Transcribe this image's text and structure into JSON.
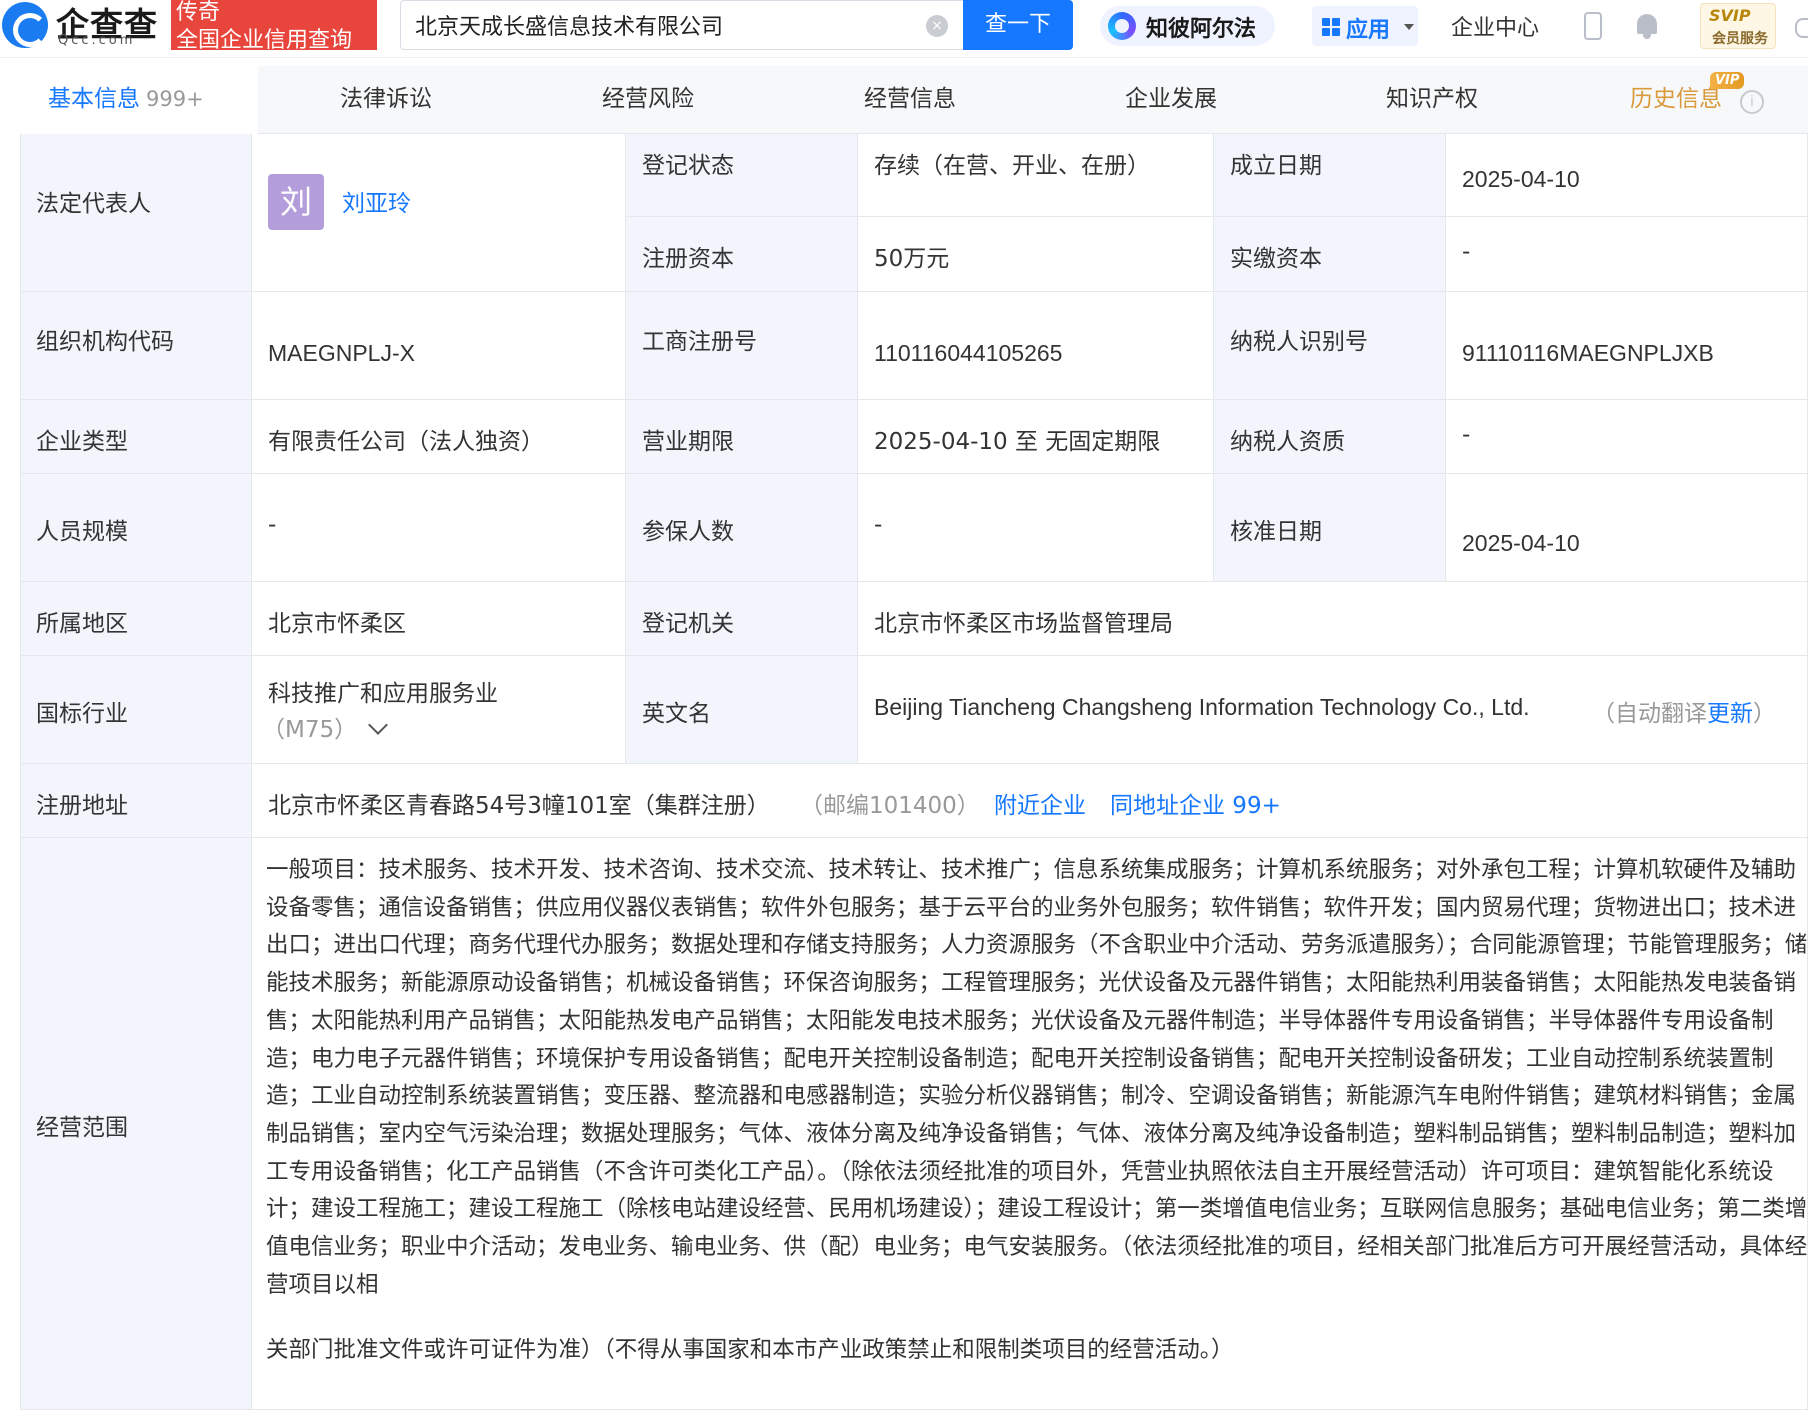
{
  "header": {
    "logo_text": "企查查",
    "logo_sub": "Qcc.com",
    "legend_badge_line1": "传奇",
    "legend_badge_line2": "全国企业信用查询",
    "search_value": "北京天成长盛信息技术有限公司",
    "search_button": "查一下",
    "zhipi_label": "知彼阿尔法",
    "apps_label": "应用",
    "enterprise_center": "企业中心",
    "svip_top": "SVIP",
    "svip_bottom": "会员服务"
  },
  "tabs": [
    {
      "label": "基本信息",
      "count": "999+"
    },
    {
      "label": "法律诉讼"
    },
    {
      "label": "经营风险"
    },
    {
      "label": "经营信息"
    },
    {
      "label": "企业发展"
    },
    {
      "label": "知识产权"
    },
    {
      "label": "历史信息"
    }
  ],
  "vip_tag": "VIP",
  "info": {
    "legal_rep_label": "法定代表人",
    "legal_rep_avatar": "刘",
    "legal_rep_name": "刘亚玲",
    "status_label": "登记状态",
    "status_value": "存续（在营、开业、在册）",
    "founded_label": "成立日期",
    "founded_value": "2025-04-10",
    "reg_capital_label": "注册资本",
    "reg_capital_value": "50万元",
    "paid_capital_label": "实缴资本",
    "paid_capital_value": "-",
    "org_code_label": "组织机构代码",
    "org_code_value": "MAEGNPLJ-X",
    "biz_reg_no_label": "工商注册号",
    "biz_reg_no_value": "110116044105265",
    "taxpayer_id_label": "纳税人识别号",
    "taxpayer_id_value": "91110116MAEGNPLJXB",
    "company_type_label": "企业类型",
    "company_type_value": "有限责任公司（法人独资）",
    "term_label": "营业期限",
    "term_value": "2025-04-10 至 无固定期限",
    "taxpayer_qual_label": "纳税人资质",
    "taxpayer_qual_value": "-",
    "staff_size_label": "人员规模",
    "staff_size_value": "-",
    "insured_label": "参保人数",
    "insured_value": "-",
    "approval_date_label": "核准日期",
    "approval_date_value": "2025-04-10",
    "region_label": "所属地区",
    "region_value": "北京市怀柔区",
    "authority_label": "登记机关",
    "authority_value": "北京市怀柔区市场监督管理局",
    "industry_label": "国标行业",
    "industry_value": "科技推广和应用服务业",
    "industry_code": "（M75）",
    "english_name_label": "英文名",
    "english_name_value": "Beijing Tiancheng Changsheng Information Technology Co., Ltd.",
    "auto_translate_prefix": "（自动翻译",
    "auto_translate_link": "更新",
    "auto_translate_suffix": "）",
    "address_label": "注册地址",
    "address_value": "北京市怀柔区青春路54号3幢101室（集群注册）",
    "postal_code": "（邮编101400）",
    "nearby_link": "附近企业",
    "same_address_link": "同地址企业 99+",
    "scope_label": "经营范围",
    "scope_text": "一般项目：技术服务、技术开发、技术咨询、技术交流、技术转让、技术推广；信息系统集成服务；计算机系统服务；对外承包工程；计算机软硬件及辅助设备零售；通信设备销售；供应用仪器仪表销售；软件外包服务；基于云平台的业务外包服务；软件销售；软件开发；国内贸易代理；货物进出口；技术进出口；进出口代理；商务代理代办服务；数据处理和存储支持服务；人力资源服务（不含职业中介活动、劳务派遣服务）；合同能源管理；节能管理服务；储能技术服务；新能源原动设备销售；机械设备销售；环保咨询服务；工程管理服务；光伏设备及元器件销售；太阳能热利用装备销售；太阳能热发电装备销售；太阳能热利用产品销售；太阳能热发电产品销售；太阳能发电技术服务；光伏设备及元器件制造；半导体器件专用设备销售；半导体器件专用设备制造；电力电子元器件销售；环境保护专用设备销售；配电开关控制设备制造；配电开关控制设备销售；配电开关控制设备研发；工业自动控制系统装置制造；工业自动控制系统装置销售；变压器、整流器和电感器制造；实验分析仪器销售；制冷、空调设备销售；新能源汽车电附件销售；建筑材料销售；金属制品销售；室内空气污染治理；数据处理服务；气体、液体分离及纯净设备销售；气体、液体分离及纯净设备制造；塑料制品销售；塑料制品制造；塑料加工专用设备销售；化工产品销售（不含许可类化工产品）。（除依法须经批准的项目外，凭营业执照依法自主开展经营活动）许可项目：建筑智能化系统设计；建设工程施工；建设工程施工（除核电站建设经营、民用机场建设）；建设工程设计；第一类增值电信业务；互联网信息服务；基础电信业务；第二类增值电信业务；职业中介活动；发电业务、输电业务、供（配）电业务；电气安装服务。（依法须经批准的项目，经相关部门批准后方可开展经营活动，具体经营项目以相",
    "scope_text_last": "关部门批准文件或许可证件为准）（不得从事国家和本市产业政策禁止和限制类项目的经营活动。）"
  },
  "colors": {
    "accent": "#1677ff",
    "brand_red": "#e8453c",
    "label_bg": "#f2f6fc",
    "history_tab": "#d99a3c"
  }
}
